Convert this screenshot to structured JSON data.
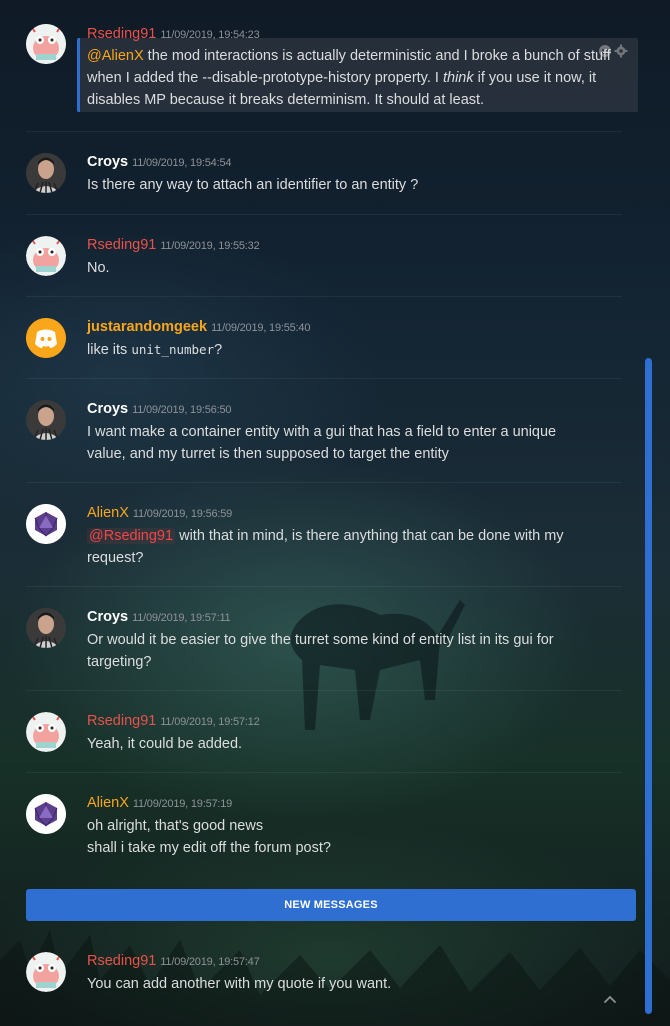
{
  "colors": {
    "rseding": "#e8524a",
    "croys": "#ffffff",
    "justarandomgeek": "#faa61a",
    "alienx": "#faa61a",
    "accent": "#2e6fd1"
  },
  "messages": [
    {
      "author": "Rseding91",
      "timestamp": "11/09/2019, 19:54:23",
      "avatar_icon": "zoidberg-avatar",
      "parts": {
        "mention": "@AlienX",
        "t1": " the mod interactions is actually deterministic and I broke a bunch of stuff when I added the --disable-prototype-history property. I ",
        "em": "think",
        "t2": " if you use it now, it disables MP because it breaks determinism. It should at least."
      }
    },
    {
      "author": "Croys",
      "timestamp": "11/09/2019, 19:54:54",
      "avatar_icon": "croys-avatar",
      "text": "Is there any way to attach an identifier to an entity ?"
    },
    {
      "author": "Rseding91",
      "timestamp": "11/09/2019, 19:55:32",
      "avatar_icon": "zoidberg-avatar",
      "text": "No."
    },
    {
      "author": "justarandomgeek",
      "timestamp": "11/09/2019, 19:55:40",
      "avatar_icon": "discord-logo-avatar",
      "parts": {
        "t1": "like its ",
        "code": "unit_number",
        "t2": "?"
      }
    },
    {
      "author": "Croys",
      "timestamp": "11/09/2019, 19:56:50",
      "avatar_icon": "croys-avatar",
      "text": "I want make a container entity with a gui that has a field to enter a unique value, and my turret is then supposed to target the entity"
    },
    {
      "author": "AlienX",
      "timestamp": "11/09/2019, 19:56:59",
      "avatar_icon": "d20-avatar",
      "parts": {
        "mention": "@Rseding91",
        "t1": " with that in mind, is there anything that can be done with my request?"
      }
    },
    {
      "author": "Croys",
      "timestamp": "11/09/2019, 19:57:11",
      "avatar_icon": "croys-avatar",
      "text": "Or would it be easier to give the turret some kind of entity list in its gui for targeting?"
    },
    {
      "author": "Rseding91",
      "timestamp": "11/09/2019, 19:57:12",
      "avatar_icon": "zoidberg-avatar",
      "text": "Yeah, it could be added."
    },
    {
      "author": "AlienX",
      "timestamp": "11/09/2019, 19:57:19",
      "avatar_icon": "d20-avatar",
      "lines": [
        "oh alright, that's good news",
        "shall i take my edit off the forum post?"
      ]
    },
    {
      "author": "Rseding91",
      "timestamp": "11/09/2019, 19:57:47",
      "avatar_icon": "zoidberg-avatar",
      "text": "You can add another with my quote if you want."
    }
  ],
  "new_messages_label": "NEW MESSAGES",
  "icons": {
    "reaction": "emoji-icon",
    "settings": "gear-icon",
    "jump": "chevron-up-icon"
  }
}
